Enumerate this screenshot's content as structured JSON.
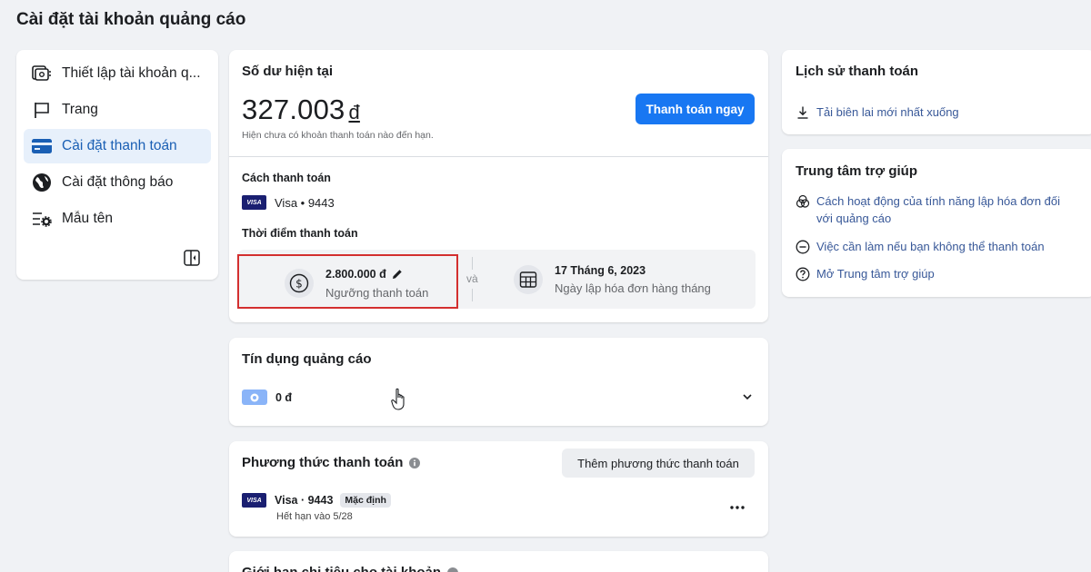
{
  "page_title": "Cài đặt tài khoản quảng cáo",
  "sidebar": {
    "items": [
      {
        "label": "Thiết lập tài khoản q...",
        "icon": "account-settings-icon",
        "active": false
      },
      {
        "label": "Trang",
        "icon": "flag-icon",
        "active": false
      },
      {
        "label": "Cài đặt thanh toán",
        "icon": "credit-card-icon",
        "active": true
      },
      {
        "label": "Cài đặt thông báo",
        "icon": "globe-icon",
        "active": false
      },
      {
        "label": "Mẫu tên",
        "icon": "naming-template-icon",
        "active": false
      }
    ]
  },
  "balance": {
    "title": "Số dư hiện tại",
    "amount": "327.003",
    "currency": "đ",
    "note": "Hiện chưa có khoản thanh toán nào đến hạn.",
    "pay_now": "Thanh toán ngay"
  },
  "payment_method_section": {
    "title": "Cách thanh toán",
    "card_brand": "VISA",
    "card": "Visa • 9443"
  },
  "payment_timing": {
    "title": "Thời điểm thanh toán",
    "threshold_value": "2.800.000 đ",
    "threshold_label": "Ngưỡng thanh toán",
    "connector": "và",
    "billing_date": "17 Tháng 6, 2023",
    "billing_label": "Ngày lập hóa đơn hàng tháng"
  },
  "ad_credit": {
    "title": "Tín dụng quảng cáo",
    "amount": "0 đ"
  },
  "methods": {
    "title": "Phương thức thanh toán",
    "add_button": "Thêm phương thức thanh toán",
    "card_brand": "VISA",
    "card": "Visa · 9443",
    "default_badge": "Mặc định",
    "expiry": "Hết hạn vào 5/28"
  },
  "spending_limit": {
    "title": "Giới hạn chi tiêu cho tài khoản"
  },
  "history": {
    "title": "Lịch sử thanh toán",
    "download_link": "Tải biên lai mới nhất xuống"
  },
  "help": {
    "title": "Trung tâm trợ giúp",
    "links": [
      {
        "label": "Cách hoạt động của tính năng lập hóa đơn đối với quảng cáo",
        "icon": "venn-icon"
      },
      {
        "label": "Việc cần làm nếu bạn không thể thanh toán",
        "icon": "minus-circle-icon"
      },
      {
        "label": "Mở Trung tâm trợ giúp",
        "icon": "question-circle-icon"
      }
    ]
  },
  "colors": {
    "primary": "#1877f2",
    "highlight_border": "#d32f2f",
    "active_nav_bg": "#e7f0fb",
    "link": "#385898"
  }
}
